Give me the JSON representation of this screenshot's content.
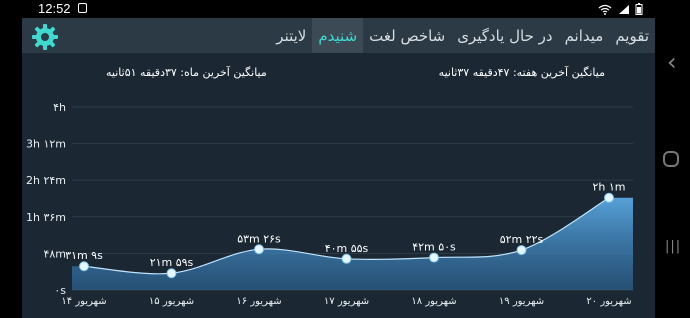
{
  "status_bar": {
    "time": "12:52",
    "right_icons": "wifi signal battery"
  },
  "app": {
    "tabs": [
      {
        "label": "تقویم",
        "active": false
      },
      {
        "label": "میدانم",
        "active": false
      },
      {
        "label": "در حال یادگیری",
        "active": false
      },
      {
        "label": "شاخص لغت",
        "active": false
      },
      {
        "label": "شنیدم",
        "active": true
      },
      {
        "label": "لایتنر",
        "active": false
      }
    ],
    "settings_icon": "gear-icon",
    "week_average": "میانگین آخرین هفته: ۴۷دقیقه  ۳۷ثانیه",
    "month_average": "میانگین آخرین ماه: ۳۷دقیقه  ۵۱ثانیه",
    "colors": {
      "accent": "#3fd9d0",
      "background": "#1b2833",
      "topbar": "#2c3a45",
      "fill": "#4a90c8"
    }
  },
  "chart_data": {
    "type": "area",
    "title": "",
    "x": [
      "۱۴ شهریور",
      "۱۵ شهریور",
      "۱۶ شهریور",
      "۱۷ شهریور",
      "۱۸ شهریور",
      "۱۹ شهریور",
      "۲۰ شهریور"
    ],
    "values": [
      1869,
      1319,
      3206,
      2455,
      2550,
      3142,
      7260
    ],
    "point_labels": [
      "۳۱m ۹s",
      "۲۱m ۵۹s",
      "۵۳m ۲۶s",
      "۴۰m ۵۵s",
      "۴۲m ۵۰s",
      "۵۲m ۲۲s",
      "۲h ۱m"
    ],
    "y_ticks": [
      {
        "value": 0,
        "label": "۰s"
      },
      {
        "value": 2880,
        "label": "۴۸m"
      },
      {
        "value": 5760,
        "label": "1h ۳۶m"
      },
      {
        "value": 8640,
        "label": "2h ۲۴m"
      },
      {
        "value": 11520,
        "label": "3h ۱۲m"
      },
      {
        "value": 14400,
        "label": "۴h"
      }
    ],
    "ylim": [
      0,
      14400
    ],
    "y_unit": "seconds",
    "grid": true,
    "xlabel": "",
    "ylabel": ""
  },
  "nav_bar": {
    "back": "‹",
    "home": "○",
    "recents": "|||"
  }
}
